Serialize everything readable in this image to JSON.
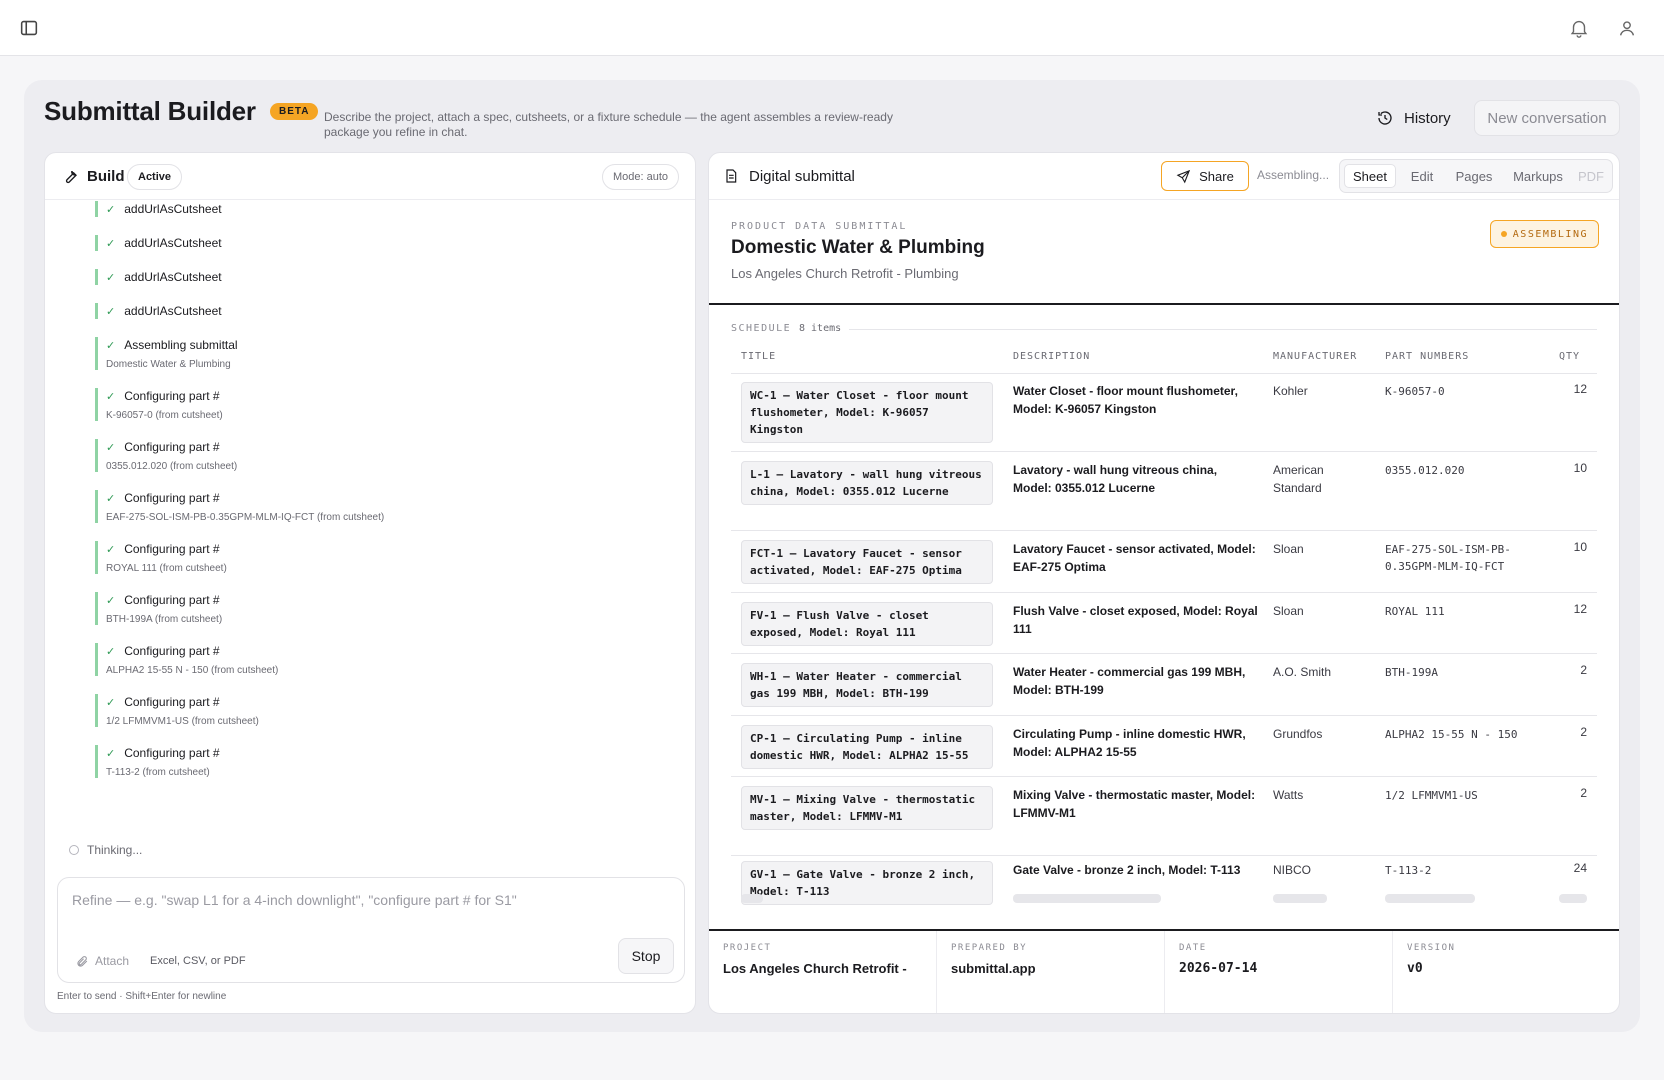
{
  "header": {
    "sidebar_icon": "sidebar-toggle-icon",
    "bell_icon": "bell-icon",
    "user_icon": "user-icon"
  },
  "page": {
    "title": "Submittal Builder",
    "badge": "BETA",
    "subtitle": "Describe the project, attach a spec, cutsheets, or a fixture schedule — the agent assembles a review-ready package you refine in chat.",
    "history_label": "History",
    "new_conversation_label": "New conversation"
  },
  "build": {
    "title": "Build",
    "status": "Active",
    "mode": "Mode: auto",
    "steps": [
      {
        "label": "addUrlAsCutsheet",
        "detail": ""
      },
      {
        "label": "addUrlAsCutsheet",
        "detail": ""
      },
      {
        "label": "addUrlAsCutsheet",
        "detail": ""
      },
      {
        "label": "addUrlAsCutsheet",
        "detail": ""
      },
      {
        "label": "Assembling submittal",
        "detail": "Domestic Water & Plumbing"
      },
      {
        "label": "Configuring part #",
        "detail": "K-96057-0 (from cutsheet)"
      },
      {
        "label": "Configuring part #",
        "detail": "0355.012.020 (from cutsheet)"
      },
      {
        "label": "Configuring part #",
        "detail": "EAF-275-SOL-ISM-PB-0.35GPM-MLM-IQ-FCT (from cutsheet)"
      },
      {
        "label": "Configuring part #",
        "detail": "ROYAL 111 (from cutsheet)"
      },
      {
        "label": "Configuring part #",
        "detail": "BTH-199A (from cutsheet)"
      },
      {
        "label": "Configuring part #",
        "detail": "ALPHA2 15-55 N - 150 (from cutsheet)"
      },
      {
        "label": "Configuring part #",
        "detail": "1/2 LFMMVM1-US (from cutsheet)"
      },
      {
        "label": "Configuring part #",
        "detail": "T-113-2 (from cutsheet)"
      }
    ],
    "thinking": "Thinking...",
    "composer": {
      "placeholder": "Refine — e.g. \"swap L1 for a 4-inch downlight\", \"configure part # for S1\"",
      "attach_label": "Attach",
      "file_types": "Excel, CSV, or PDF",
      "stop_label": "Stop",
      "hint": "Enter to send · Shift+Enter for newline"
    }
  },
  "submittal": {
    "panel_title": "Digital submittal",
    "share_label": "Share",
    "assembling_label": "Assembling...",
    "tabs": [
      "Sheet",
      "Edit",
      "Pages",
      "Markups",
      "PDF"
    ],
    "selected_tab": "Sheet",
    "eyebrow": "PRODUCT DATA SUBMITTAL",
    "title": "Domestic Water & Plumbing",
    "subtitle": "Los Angeles Church Retrofit - Plumbing",
    "status": "ASSEMBLING",
    "schedule_label": "SCHEDULE",
    "schedule_count": "8 items",
    "columns": [
      "TITLE",
      "DESCRIPTION",
      "MANUFACTURER",
      "PART NUMBERS",
      "QTY"
    ],
    "rows": [
      {
        "title": "WC-1 — Water Closet - floor mount flushometer, Model: K-96057 Kingston",
        "description": "Water Closet - floor mount flushometer, Model: K-96057 Kingston",
        "manufacturer": "Kohler",
        "part": "K-96057-0",
        "qty": "12"
      },
      {
        "title": "L-1 — Lavatory - wall hung vitreous china, Model: 0355.012 Lucerne",
        "description": "Lavatory - wall hung vitreous china, Model: 0355.012 Lucerne",
        "manufacturer": "American Standard",
        "part": "0355.012.020",
        "qty": "10"
      },
      {
        "title": "FCT-1 — Lavatory Faucet - sensor activated, Model: EAF-275 Optima",
        "description": "Lavatory Faucet - sensor activated, Model: EAF-275 Optima",
        "manufacturer": "Sloan",
        "part": "EAF-275-SOL-ISM-PB-0.35GPM-MLM-IQ-FCT",
        "qty": "10"
      },
      {
        "title": "FV-1 — Flush Valve - closet exposed, Model: Royal 111",
        "description": "Flush Valve - closet exposed, Model: Royal 111",
        "manufacturer": "Sloan",
        "part": "ROYAL 111",
        "qty": "12"
      },
      {
        "title": "WH-1 — Water Heater - commercial gas 199 MBH, Model: BTH-199",
        "description": "Water Heater - commercial gas 199 MBH, Model: BTH-199",
        "manufacturer": "A.O. Smith",
        "part": "BTH-199A",
        "qty": "2"
      },
      {
        "title": "CP-1 — Circulating Pump - inline domestic HWR, Model: ALPHA2 15-55",
        "description": "Circulating Pump - inline domestic HWR, Model: ALPHA2 15-55",
        "manufacturer": "Grundfos",
        "part": "ALPHA2 15-55 N - 150",
        "qty": "2"
      },
      {
        "title": "MV-1 — Mixing Valve - thermostatic master, Model: LFMMV-M1",
        "description": "Mixing Valve - thermostatic master, Model: LFMMV-M1",
        "manufacturer": "Watts",
        "part": "1/2 LFMMVM1-US",
        "qty": "2"
      },
      {
        "title": "GV-1 — Gate Valve - bronze 2 inch, Model: T-113",
        "description": "Gate Valve - bronze 2 inch, Model: T-113",
        "manufacturer": "NIBCO",
        "part": "T-113-2",
        "qty": "24"
      }
    ],
    "footer": {
      "project_label": "PROJECT",
      "project_value": "Los Angeles Church Retrofit -",
      "prepared_label": "PREPARED BY",
      "prepared_value": "submittal.app",
      "date_label": "DATE",
      "date_value": "2026-07-14",
      "version_label": "VERSION",
      "version_value": "v0"
    }
  },
  "colors": {
    "accent": "#f5a524",
    "success": "#2f9a55",
    "step_bar": "#8fd3a4"
  }
}
